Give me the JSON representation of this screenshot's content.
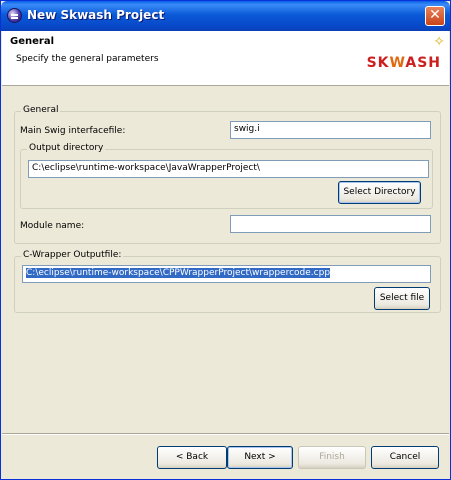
{
  "window": {
    "title": "New Skwash Project",
    "app_icon": "eclipse-icon",
    "close_label": "✕"
  },
  "banner": {
    "title": "General",
    "description": "Specify the general parameters",
    "star_icon": "wizard-star-icon",
    "logo_parts": [
      "SK",
      "W",
      "ASH"
    ]
  },
  "general": {
    "legend": "General",
    "main_swig_label": "Main Swig interfacefile:",
    "main_swig_value": "swig.i",
    "output_dir_legend": "Output directory",
    "output_dir_value": "C:\\eclipse\\runtime-workspace\\JavaWrapperProject\\",
    "select_directory_label": "Select Directory",
    "module_name_label": "Module name:",
    "module_name_value": ""
  },
  "cwrapper": {
    "legend": "C-Wrapper Outputfile:",
    "value": "C:\\eclipse\\runtime-workspace\\CPPWrapperProject\\wrappercode.cpp",
    "select_file_label": "Select file"
  },
  "footer": {
    "back_label": "< Back",
    "next_label": "Next >",
    "finish_label": "Finish",
    "cancel_label": "Cancel"
  }
}
